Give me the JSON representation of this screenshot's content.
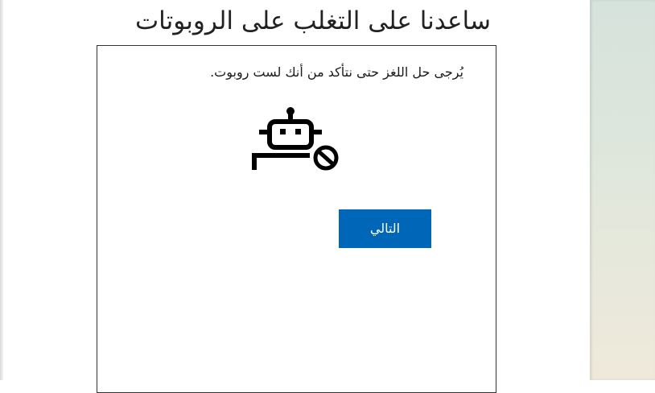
{
  "page": {
    "title": "ساعدنا على التغلب على الروبوتات"
  },
  "challenge": {
    "instruction": "يُرجى حل اللغز حتى نتأكد من أنك لست روبوت.",
    "icon": "robot-blocked-icon",
    "next_label": "التالي"
  },
  "colors": {
    "accent": "#0067b8",
    "text": "#222222",
    "border": "#333333"
  }
}
